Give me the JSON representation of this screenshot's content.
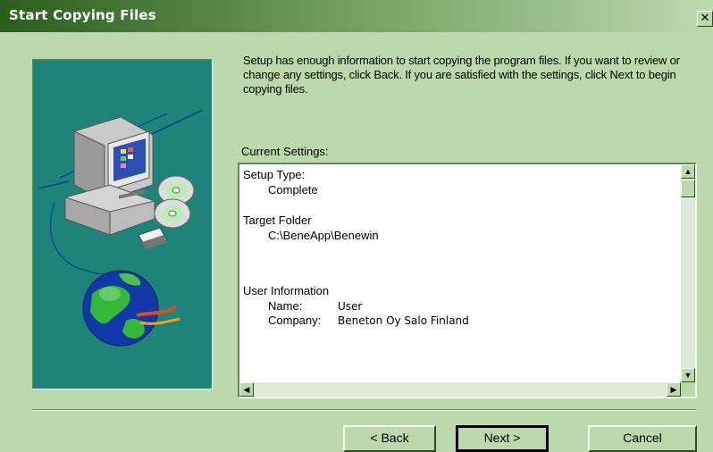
{
  "window": {
    "title": "Start Copying Files",
    "close_glyph": "✕"
  },
  "intro_text": "Setup has enough information to start copying the program files.  If you want to review or change any settings, click Back.  If you are satisfied with the settings, click Next to begin copying files.",
  "settings_label": "Current Settings:",
  "settings": {
    "setup_type": {
      "heading": "Setup Type:",
      "value": "Complete"
    },
    "target_folder": {
      "heading": "Target Folder",
      "value": "C:\\BeneApp\\Benewin"
    },
    "user_info": {
      "heading": "User Information",
      "name_key": "Name:",
      "name_value": "User",
      "company_key": "Company:",
      "company_value": "Beneton Oy Salo Finland"
    }
  },
  "buttons": {
    "back": "< Back",
    "next": "Next >",
    "cancel": "Cancel"
  },
  "scroll_glyphs": {
    "up": "▲",
    "down": "▼",
    "left": "◀",
    "right": "▶"
  },
  "colors": {
    "dialog_background": "#bcd9ae",
    "art_panel": "#1e8479",
    "titlebar_start": "#2a5e1c"
  },
  "icons": [
    "computer-icon",
    "cd-disc-icon",
    "floppy-disk-icon",
    "globe-icon",
    "close-icon"
  ]
}
